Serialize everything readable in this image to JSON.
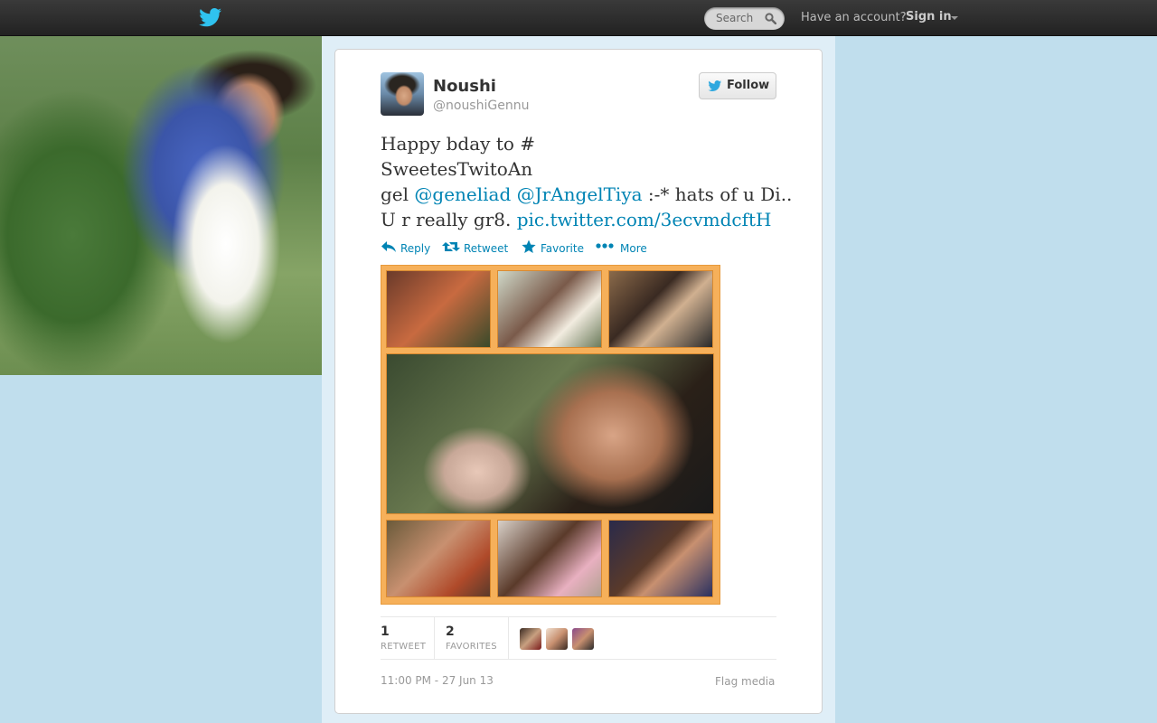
{
  "topbar": {
    "search_placeholder": "Search",
    "account_prompt": "Have an account?",
    "signin_label": "Sign in"
  },
  "tweet": {
    "author_name": "Noushi",
    "author_handle": "@noushiGennu",
    "follow_label": "Follow",
    "text": {
      "line1": "Happy bday to #",
      "line2": "SweetesTwitoAn",
      "line3_prefix": "gel ",
      "mention1": "@geneliad",
      "mention2": "@JrAngelTiya",
      "line3_suffix": " :-* hats of u Di..",
      "line4_prefix": "U r really gr8. ",
      "link": "pic.twitter.com/3ecvmdcftH"
    },
    "actions": {
      "reply": "Reply",
      "retweet": "Retweet",
      "favorite": "Favorite",
      "more": "More"
    },
    "stats": {
      "retweets_count": "1",
      "retweets_label": "RETWEET",
      "favorites_count": "2",
      "favorites_label": "FAVORITES"
    },
    "timestamp": "11:00 PM - 27 Jun 13",
    "flag_label": "Flag media"
  },
  "colors": {
    "link": "#0084b4",
    "background": "#c0deed",
    "topbar": "#222222",
    "media_frame": "#f6b05a"
  },
  "icons": [
    "twitter-bird-icon",
    "search-icon",
    "caret-down-icon",
    "reply-icon",
    "retweet-icon",
    "star-icon",
    "more-dots-icon"
  ]
}
